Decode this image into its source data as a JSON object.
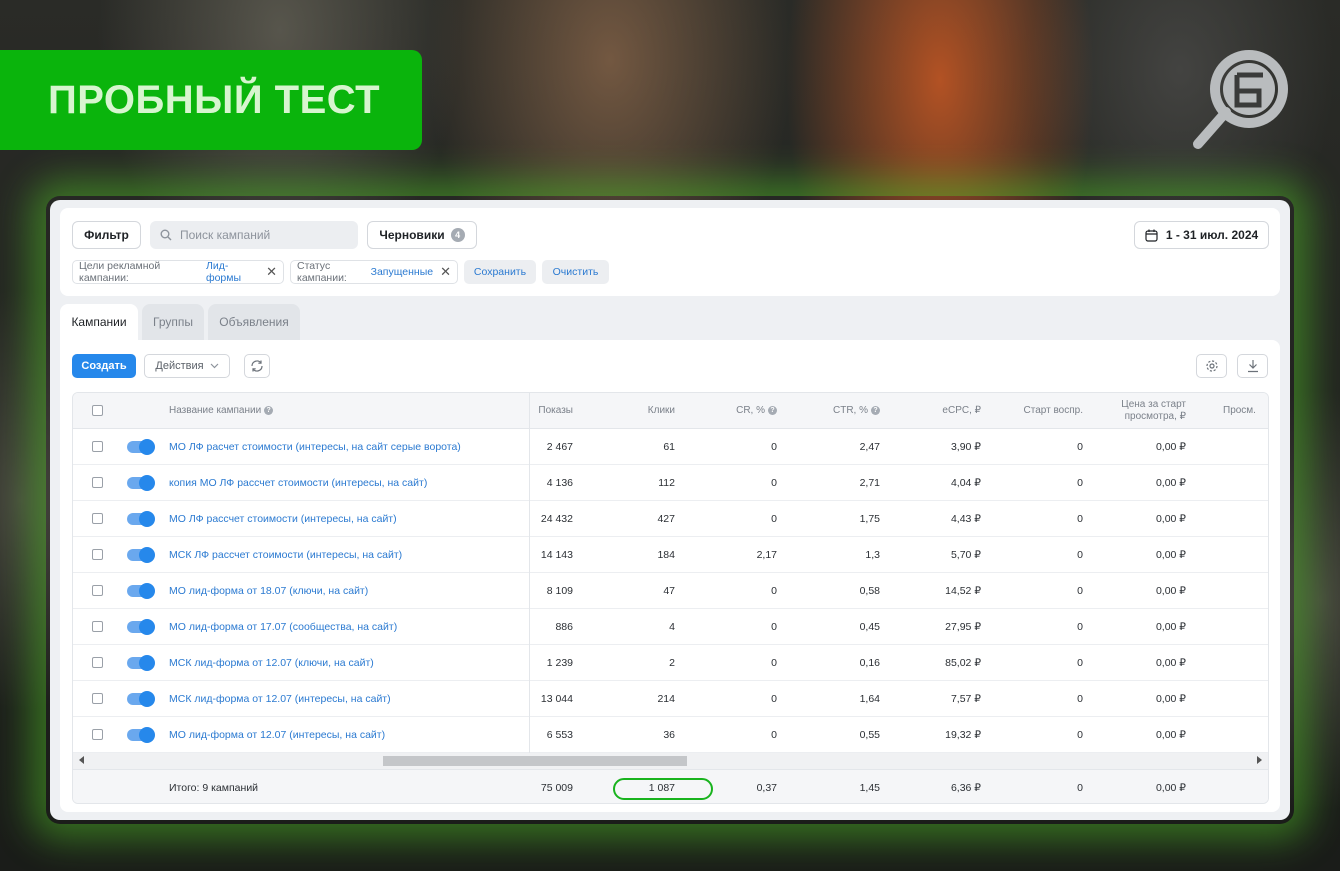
{
  "banner": {
    "title": "ПРОБНЫЙ ТЕСТ"
  },
  "filter": {
    "filter_button": "Фильтр",
    "search_placeholder": "Поиск кампаний",
    "drafts_label": "Черновики",
    "drafts_count": "4",
    "date_range": "1 - 31 июл. 2024",
    "chips": [
      {
        "label": "Цели рекламной кампании:",
        "value": "Лид-формы"
      },
      {
        "label": "Статус кампании:",
        "value": "Запущенные"
      }
    ],
    "save_label": "Сохранить",
    "clear_label": "Очистить"
  },
  "tabs": [
    {
      "label": "Кампании",
      "active": true
    },
    {
      "label": "Группы",
      "active": false
    },
    {
      "label": "Объявления",
      "active": false
    }
  ],
  "toolbar": {
    "create_label": "Создать",
    "actions_label": "Действия",
    "icons": [
      "refresh-icon",
      "settings-icon",
      "download-icon"
    ]
  },
  "table": {
    "columns": {
      "name": "Название кампании",
      "shows": "Показы",
      "clicks": "Клики",
      "cr": "CR, %",
      "ctr": "CTR, %",
      "ecpc": "eCPC, ₽",
      "start": "Старт воспр.",
      "price_line1": "Цена за старт",
      "price_line2": "просмотра, ₽",
      "views": "Просм."
    },
    "rows": [
      {
        "name": "МО ЛФ расчет стоимости (интересы, на сайт серые ворота)",
        "shows": "2 467",
        "clicks": "61",
        "cr": "0",
        "ctr": "2,47",
        "ecpc": "3,90 ₽",
        "start": "0",
        "price": "0,00 ₽"
      },
      {
        "name": "копия МО ЛФ рассчет стоимости (интересы, на сайт)",
        "shows": "4 136",
        "clicks": "112",
        "cr": "0",
        "ctr": "2,71",
        "ecpc": "4,04 ₽",
        "start": "0",
        "price": "0,00 ₽"
      },
      {
        "name": "МО ЛФ рассчет стоимости (интересы, на сайт)",
        "shows": "24 432",
        "clicks": "427",
        "cr": "0",
        "ctr": "1,75",
        "ecpc": "4,43 ₽",
        "start": "0",
        "price": "0,00 ₽"
      },
      {
        "name": "МСК ЛФ рассчет стоимости (интересы, на сайт)",
        "shows": "14 143",
        "clicks": "184",
        "cr": "2,17",
        "ctr": "1,3",
        "ecpc": "5,70 ₽",
        "start": "0",
        "price": "0,00 ₽"
      },
      {
        "name": "МО лид-форма от 18.07 (ключи, на сайт)",
        "shows": "8 109",
        "clicks": "47",
        "cr": "0",
        "ctr": "0,58",
        "ecpc": "14,52 ₽",
        "start": "0",
        "price": "0,00 ₽"
      },
      {
        "name": "МО лид-форма от 17.07 (сообщества, на сайт)",
        "shows": "886",
        "clicks": "4",
        "cr": "0",
        "ctr": "0,45",
        "ecpc": "27,95 ₽",
        "start": "0",
        "price": "0,00 ₽"
      },
      {
        "name": "МСК лид-форма от 12.07 (ключи, на сайт)",
        "shows": "1 239",
        "clicks": "2",
        "cr": "0",
        "ctr": "0,16",
        "ecpc": "85,02 ₽",
        "start": "0",
        "price": "0,00 ₽"
      },
      {
        "name": "МСК лид-форма от 12.07 (интересы, на сайт)",
        "shows": "13 044",
        "clicks": "214",
        "cr": "0",
        "ctr": "1,64",
        "ecpc": "7,57 ₽",
        "start": "0",
        "price": "0,00 ₽"
      },
      {
        "name": "МО лид-форма от 12.07 (интересы, на сайт)",
        "shows": "6 553",
        "clicks": "36",
        "cr": "0",
        "ctr": "0,55",
        "ecpc": "19,32 ₽",
        "start": "0",
        "price": "0,00 ₽"
      }
    ],
    "total": {
      "label": "Итого: 9 кампаний",
      "shows": "75 009",
      "clicks": "1 087",
      "cr": "0,37",
      "ctr": "1,45",
      "ecpc": "6,36 ₽",
      "start": "0",
      "price": "0,00 ₽"
    }
  },
  "colors": {
    "accent": "#2688eb",
    "banner": "#0ab40c",
    "highlight": "#19b31e"
  }
}
